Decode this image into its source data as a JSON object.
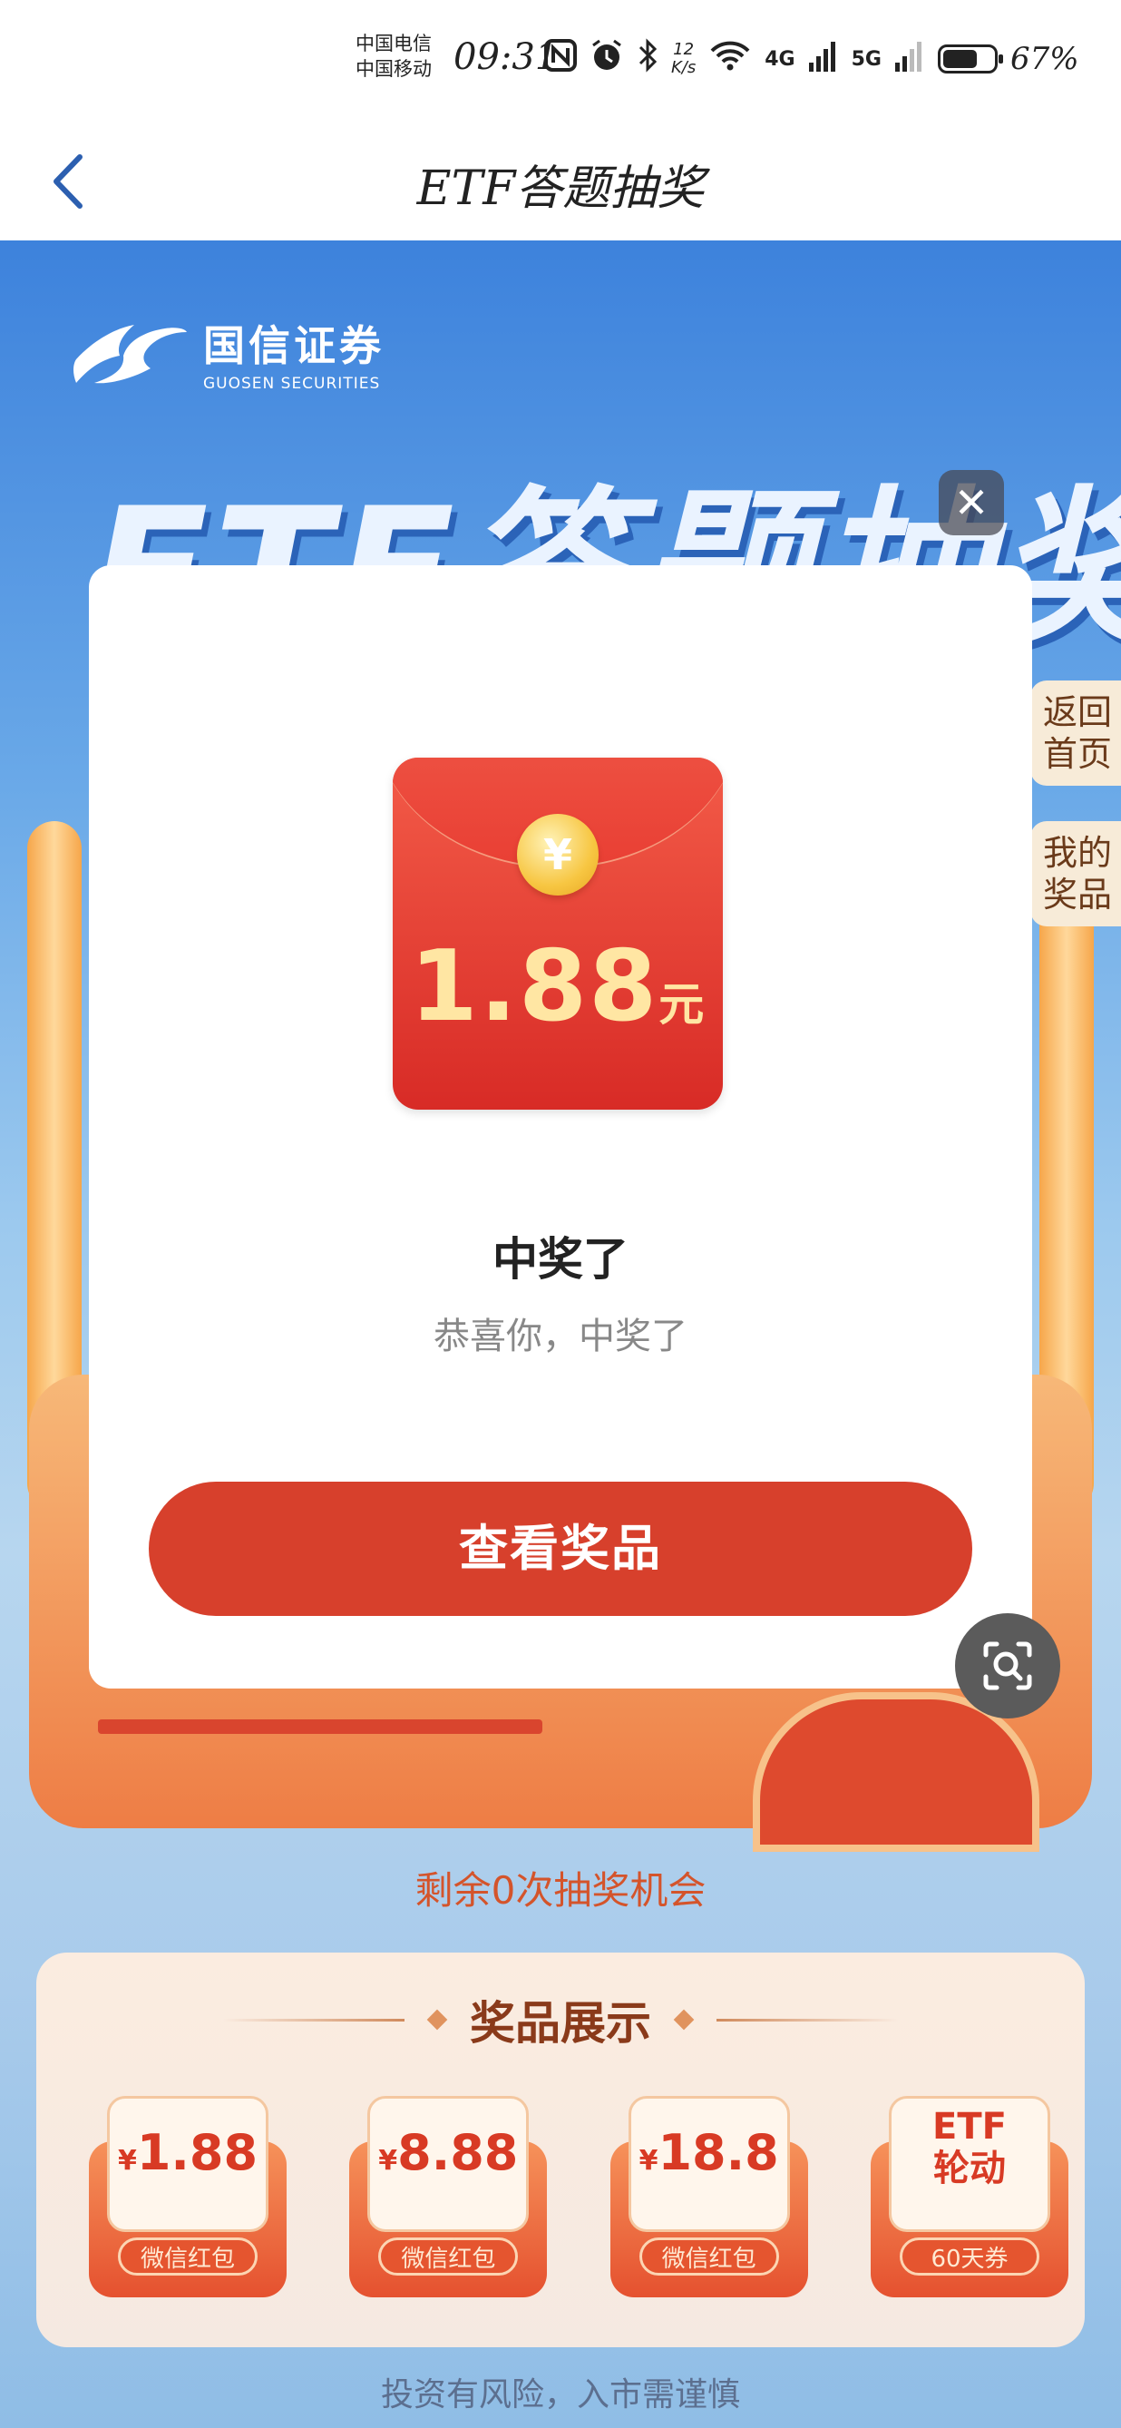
{
  "status_bar": {
    "carrier1": "中国电信",
    "carrier2": "中国移动",
    "time": "09:31",
    "speed_value": "12",
    "speed_unit": "K/s",
    "net1": "4G",
    "net2": "5G",
    "battery_pct": "67%"
  },
  "nav": {
    "title": "ETF答题抽奖"
  },
  "page": {
    "logo_cn": "国信证券",
    "logo_en": "GUOSEN SECURITIES",
    "banner_title": "ETF答题抽奖",
    "side_tab_home": "返回首页",
    "side_tab_prizes": "我的奖品",
    "remaining": "剩余0次抽奖机会",
    "prize_title": "奖品展示",
    "prizes": [
      {
        "amount_symbol": "¥",
        "amount": "1.88",
        "label": "微信红包"
      },
      {
        "amount_symbol": "¥",
        "amount": "8.88",
        "label": "微信红包"
      },
      {
        "amount_symbol": "¥",
        "amount": "18.8",
        "label": "微信红包"
      },
      {
        "line1": "ETF",
        "line2": "轮动",
        "label": "60天券"
      }
    ],
    "disclaimer": "投资有风险，入市需谨慎"
  },
  "modal": {
    "close_symbol": "✕",
    "coin_symbol": "¥",
    "envelope_amount": "1.88",
    "envelope_unit": "元",
    "title": "中奖了",
    "subtitle": "恭喜你，中奖了",
    "button": "查看奖品"
  },
  "colors": {
    "accent": "#d7402c",
    "page_blue": "#3d82dc",
    "prize_red": "#d83a24"
  }
}
